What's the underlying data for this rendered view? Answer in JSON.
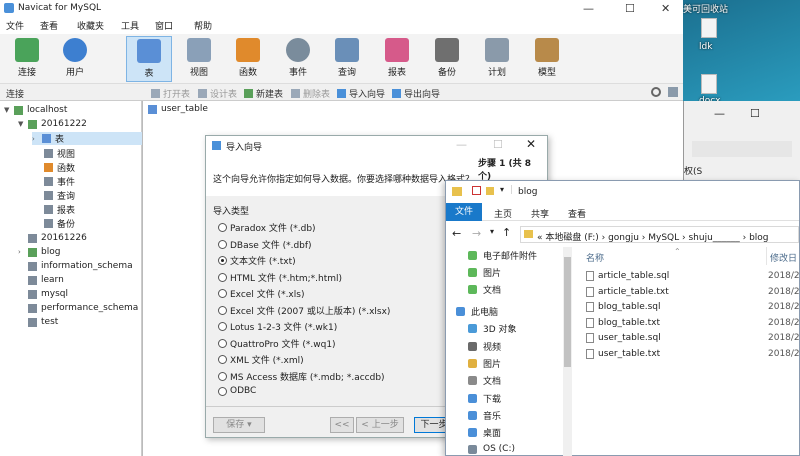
{
  "desktop": {
    "top_text": "美可回收站",
    "icon_labels": [
      "ldk",
      "docx"
    ]
  },
  "navicat": {
    "title": "Navicat for MySQL",
    "window_controls": [
      "—",
      "☐",
      "✕"
    ],
    "menu": [
      "文件",
      "查看",
      "收藏夹",
      "工具",
      "窗口",
      "帮助"
    ],
    "toolbar": [
      {
        "label": "连接",
        "icon": "connect-icon",
        "color": "#4aa35a"
      },
      {
        "label": "用户",
        "icon": "user-icon",
        "color": "#3d7fd0"
      },
      {
        "label": "表",
        "icon": "table-icon",
        "color": "#5a8fd6"
      },
      {
        "label": "视图",
        "icon": "view-icon",
        "color": "#8aa0b8"
      },
      {
        "label": "函数",
        "icon": "function-icon",
        "color": "#e08a2c"
      },
      {
        "label": "事件",
        "icon": "event-icon",
        "color": "#7a8c9c"
      },
      {
        "label": "查询",
        "icon": "query-icon",
        "color": "#6a8fb8"
      },
      {
        "label": "报表",
        "icon": "report-icon",
        "color": "#d65a8a"
      },
      {
        "label": "备份",
        "icon": "backup-icon",
        "color": "#6f6f6f"
      },
      {
        "label": "计划",
        "icon": "schedule-icon",
        "color": "#8a9aaa"
      },
      {
        "label": "模型",
        "icon": "model-icon",
        "color": "#b88a4a"
      }
    ],
    "connection_label": "连接",
    "subtoolbar": [
      "打开表",
      "设计表",
      "新建表",
      "删除表",
      "导入向导",
      "导出向导"
    ],
    "tree": {
      "localhost": "localhost",
      "db_open": "20161222",
      "children": [
        "表",
        "视图",
        "函数",
        "事件",
        "查询",
        "报表",
        "备份"
      ],
      "dbs": [
        "20161226",
        "blog",
        "information_schema",
        "learn",
        "mysql",
        "performance_schema",
        "test"
      ]
    },
    "content_item": "user_table"
  },
  "wizard": {
    "title": "导入向导",
    "step": "步骤 1 (共 8 个)",
    "description": "这个向导允许你指定如何导入数据。你要选择哪种数据导入格式？",
    "group_label": "导入类型",
    "options": [
      "Paradox 文件 (*.db)",
      "DBase 文件 (*.dbf)",
      "文本文件 (*.txt)",
      "HTML 文件 (*.htm;*.html)",
      "Excel 文件 (*.xls)",
      "Excel 文件 (2007 或以上版本) (*.xlsx)",
      "Lotus 1-2-3 文件 (*.wk1)",
      "QuattroPro 文件 (*.wq1)",
      "XML 文件 (*.xml)",
      "MS Access 数据库 (*.mdb; *.accdb)",
      "ODBC"
    ],
    "selected_index": 2,
    "save_label": "保存",
    "first_label": "<<",
    "prev_label": "< 上一步",
    "next_label": "下一步"
  },
  "explorer": {
    "title": "blog",
    "ribbon_tabs": [
      "文件",
      "主页",
      "共享",
      "查看"
    ],
    "path": "« 本地磁盘 (F:)  ›  gongju  ›  MySQL  ›  shuju______  ›  blog",
    "nav_items": [
      {
        "label": "电子邮件附件",
        "icon": "pin-icon",
        "color": "#5db85a"
      },
      {
        "label": "图片",
        "icon": "pin-icon",
        "color": "#5db85a"
      },
      {
        "label": "文档",
        "icon": "pin-icon",
        "color": "#5db85a"
      },
      {
        "label": "此电脑",
        "icon": "computer-icon",
        "color": "#4a8fd8"
      },
      {
        "label": "3D 对象",
        "icon": "3d-objects-icon",
        "color": "#4a9ad8"
      },
      {
        "label": "视频",
        "icon": "video-folder-icon",
        "color": "#6a6a6a"
      },
      {
        "label": "图片",
        "icon": "pictures-folder-icon",
        "color": "#e0b040"
      },
      {
        "label": "文档",
        "icon": "documents-folder-icon",
        "color": "#8a8a8a"
      },
      {
        "label": "下载",
        "icon": "downloads-icon",
        "color": "#4a8fd8"
      },
      {
        "label": "音乐",
        "icon": "music-icon",
        "color": "#4a8fd8"
      },
      {
        "label": "桌面",
        "icon": "desktop-folder-icon",
        "color": "#4a8fd8"
      },
      {
        "label": "OS (C:)",
        "icon": "drive-icon",
        "color": "#7a8a9a"
      }
    ],
    "col_name": "名称",
    "col_date": "修改日",
    "files": [
      {
        "name": "article_table.sql",
        "date": "2018/2,"
      },
      {
        "name": "article_table.txt",
        "date": "2018/2,"
      },
      {
        "name": "blog_table.sql",
        "date": "2018/2,"
      },
      {
        "name": "blog_table.txt",
        "date": "2018/2,"
      },
      {
        "name": "user_table.sql",
        "date": "2018/2,"
      },
      {
        "name": "user_table.txt",
        "date": "2018/2,"
      }
    ]
  },
  "bg_window": {
    "controls": [
      "—",
      "☐"
    ],
    "fragment": "权(S"
  }
}
